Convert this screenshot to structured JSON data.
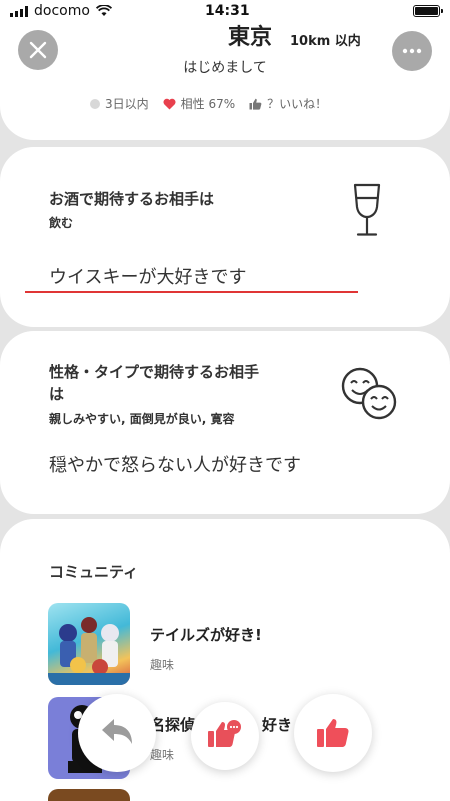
{
  "status_bar": {
    "carrier": "docomo",
    "time": "14:31"
  },
  "profile": {
    "city": "東京",
    "distance": "10km 以内",
    "greeting": "はじめまして",
    "last_login": "3日以内",
    "compatibility": "相性 67%",
    "likes": "？いいね！"
  },
  "drink": {
    "title": "お酒で期待するお相手は",
    "value": "飲む",
    "comment": "ウイスキーが大好きです"
  },
  "personality": {
    "title_line1": "性格・タイプで期待するお相手",
    "title_line2": "は",
    "value": "親しみやすい, 面倒見が良い, 寛容",
    "comment": "穏やかで怒らない人が好きです"
  },
  "community": {
    "title": "コミュニティ",
    "items": [
      {
        "name": "テイルズが好き!",
        "category": "趣味"
      },
      {
        "name": "名探偵",
        "name_tail": "好き",
        "category": "趣味"
      }
    ]
  },
  "icons": {
    "close": "close-icon",
    "more": "more-icon",
    "glass": "wine-glass-icon",
    "masks": "smiling-faces-icon",
    "back": "undo-arrow-icon",
    "message_like": "message-like-icon",
    "like": "thumbs-up-icon"
  },
  "colors": {
    "accent": "#e8404d",
    "underline": "#e03535",
    "gray_button": "#a9a9a9"
  }
}
